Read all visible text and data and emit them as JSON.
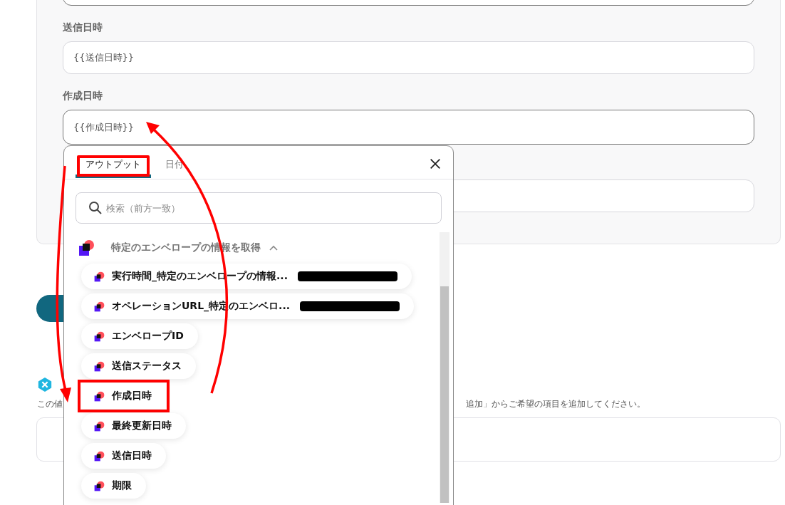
{
  "form": {
    "fields": [
      {
        "active": true
      },
      {
        "label": "送信日時",
        "value": "{{送信日時}}",
        "active": false
      },
      {
        "label": "作成日時",
        "value": "{{作成日時}}",
        "active": true
      },
      {
        "active": false
      }
    ]
  },
  "note": {
    "text_start": "この値",
    "text_end": "追加」からご希望の項目を追加してください。"
  },
  "popup": {
    "tabs": [
      {
        "label": "アウトプット",
        "selected": true,
        "annotated": true
      },
      {
        "label": "日付",
        "selected": false,
        "annotated": false
      }
    ],
    "search": {
      "placeholder": "検索（前方一致）"
    },
    "group": {
      "title": "特定のエンベロープの情報を取得",
      "expanded": true
    },
    "items": [
      {
        "label": "実行時間_特定のエンベロープの情報...",
        "redacted": true,
        "annotated": false
      },
      {
        "label": "オペレーションURL_特定のエンベロ...",
        "redacted": true,
        "annotated": false
      },
      {
        "label": "エンベロープID",
        "redacted": false,
        "annotated": false
      },
      {
        "label": "送信ステータス",
        "redacted": false,
        "annotated": false
      },
      {
        "label": "作成日時",
        "redacted": false,
        "annotated": true
      },
      {
        "label": "最終更新日時",
        "redacted": false,
        "annotated": false
      },
      {
        "label": "送信日時",
        "redacted": false,
        "annotated": false
      },
      {
        "label": "期限",
        "redacted": false,
        "annotated": false
      }
    ]
  }
}
